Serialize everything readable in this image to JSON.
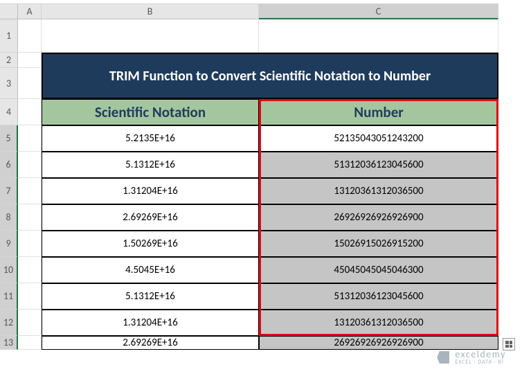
{
  "columns": [
    "A",
    "B",
    "C"
  ],
  "rows": [
    "1",
    "2",
    "3",
    "4",
    "5",
    "6",
    "7",
    "8",
    "9",
    "10",
    "11",
    "12",
    "13"
  ],
  "title": "TRIM Function to Convert Scientific Notation to Number",
  "headers": {
    "b": "Scientific Notation",
    "c": "Number"
  },
  "chart_data": {
    "type": "table",
    "columns": [
      "Scientific Notation",
      "Number"
    ],
    "rows": [
      [
        "5.2135E+16",
        "52135043051243200"
      ],
      [
        "5.1312E+16",
        "51312036123045600"
      ],
      [
        "1.31204E+16",
        "13120361312036500"
      ],
      [
        "2.69269E+16",
        "26926926926926900"
      ],
      [
        "1.50269E+16",
        "15026915026915200"
      ],
      [
        "4.5045E+16",
        "45045045045046300"
      ],
      [
        "5.1312E+16",
        "51312036123045600"
      ],
      [
        "1.31204E+16",
        "13120361312036500"
      ],
      [
        "2.69269E+16",
        "26926926926926900"
      ]
    ]
  },
  "watermark": {
    "line1": "exceldemy",
    "line2": "EXCEL · DATA · BI"
  },
  "selection": {
    "range": "C5:C13",
    "highlight_column": "C"
  }
}
